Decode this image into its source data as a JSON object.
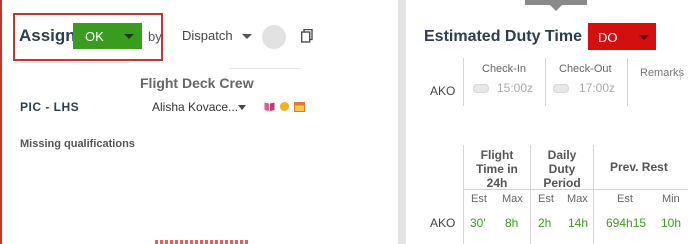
{
  "assign": {
    "label": "Assign",
    "status": "OK",
    "by_label": "by",
    "by_value": "Dispatch"
  },
  "crew": {
    "title": "Flight Deck Crew",
    "position": "PIC - LHS",
    "member": "Alisha Kovace...",
    "missing_label": "Missing qualifications"
  },
  "duty": {
    "title": "Estimated Duty Time",
    "type": "DO",
    "station": "AKO",
    "checkin_label": "Check-In",
    "checkin_time": "15:00z",
    "checkout_label": "Check-Out",
    "checkout_time": "17:00z",
    "remarks_label": "Remarks"
  },
  "limits": {
    "station": "AKO",
    "groups": [
      {
        "label": "Flight Time in 24h"
      },
      {
        "label": "Daily Duty Period"
      },
      {
        "label": "Prev. Rest"
      }
    ],
    "sub_headers": [
      "Est",
      "Max",
      "Est",
      "Max",
      "Est",
      "Min"
    ],
    "values": [
      "30'",
      "8h",
      "2h",
      "14h",
      "694h15",
      "10h"
    ]
  },
  "colors": {
    "ok_green": "#3a9c1e",
    "do_red": "#d40f0f",
    "value_green": "#3a9c1e",
    "highlight_border": "#c0392b"
  }
}
